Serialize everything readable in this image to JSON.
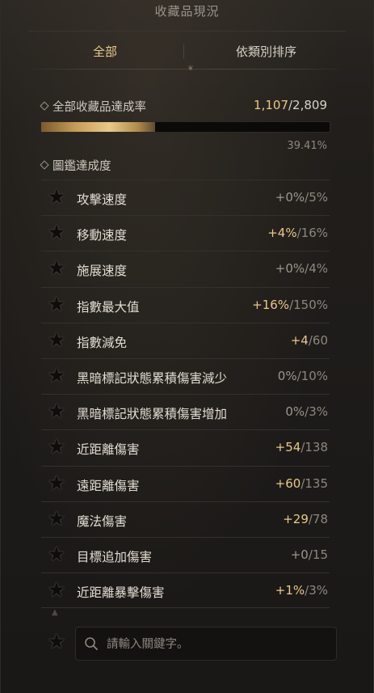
{
  "header": {
    "title": "收藏品現況"
  },
  "tabs": [
    {
      "label": "全部"
    },
    {
      "label": "依類別排序"
    }
  ],
  "total": {
    "label": "全部收藏品達成率",
    "current": "1,107",
    "max": "/2,809",
    "progress_fraction": 0.394,
    "percent": "39.41%"
  },
  "codex": {
    "label": "圖鑑達成度"
  },
  "stats": [
    {
      "name": "攻擊速度",
      "current": "+0%",
      "max": "/5%",
      "positive": false
    },
    {
      "name": "移動速度",
      "current": "+4%",
      "max": "/16%",
      "positive": true
    },
    {
      "name": "施展速度",
      "current": "+0%",
      "max": "/4%",
      "positive": false
    },
    {
      "name": "指數最大值",
      "current": "+16%",
      "max": "/150%",
      "positive": true
    },
    {
      "name": "指數減免",
      "current": "+4",
      "max": "/60",
      "positive": true
    },
    {
      "name": "黑暗標記狀態累積傷害減少",
      "current": "0%",
      "max": "/10%",
      "positive": false
    },
    {
      "name": "黑暗標記狀態累積傷害增加",
      "current": "0%",
      "max": "/3%",
      "positive": false
    },
    {
      "name": "近距離傷害",
      "current": "+54",
      "max": "/138",
      "positive": true
    },
    {
      "name": "遠距離傷害",
      "current": "+60",
      "max": "/135",
      "positive": true
    },
    {
      "name": "魔法傷害",
      "current": "+29",
      "max": "/78",
      "positive": true
    },
    {
      "name": "目標追加傷害",
      "current": "+0",
      "max": "/15",
      "positive": false
    },
    {
      "name": "近距離暴擊傷害",
      "current": "+1%",
      "max": "/3%",
      "positive": true
    }
  ],
  "search": {
    "placeholder": "請輸入關鍵字。"
  },
  "colors": {
    "accent": "#e9c98a",
    "muted": "#8d877e",
    "text": "#e2dcd2"
  },
  "icons": {
    "row": "star-icon",
    "search": "search-icon",
    "collapse": "chevron-up-icon"
  }
}
